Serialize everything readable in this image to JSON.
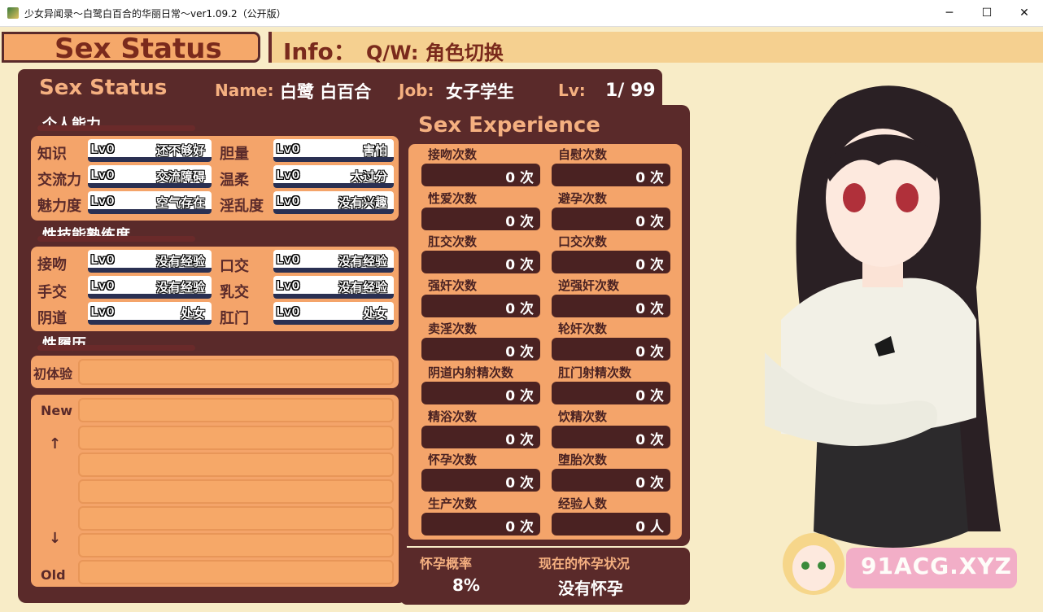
{
  "window": {
    "title": "少女异闻录～白鹭白百合的华丽日常～ver1.09.2（公开版）",
    "min_glyph": "─",
    "max_glyph": "☐",
    "close_glyph": "✕"
  },
  "header": {
    "left_title": "Sex Status",
    "info_label": "Info：",
    "info_hint": "Q/W: 角色切换"
  },
  "status": {
    "title": "Sex Status",
    "name_label": "Name:",
    "name_value": "白鹭 白百合",
    "job_label": "Job:",
    "job_value": "女子学生",
    "lv_label": "Lv:",
    "lv_value": "1/ 99"
  },
  "personal": {
    "heading": "个人能力",
    "rows": [
      {
        "label": "知识",
        "lv": "Lv0",
        "value": "还不够好"
      },
      {
        "label": "胆量",
        "lv": "Lv0",
        "value": "害怕"
      },
      {
        "label": "交流力",
        "lv": "Lv0",
        "value": "交流障碍"
      },
      {
        "label": "温柔",
        "lv": "Lv0",
        "value": "太过分"
      },
      {
        "label": "魅力度",
        "lv": "Lv0",
        "value": "空气存在"
      },
      {
        "label": "淫乱度",
        "lv": "Lv0",
        "value": "没有兴趣"
      }
    ]
  },
  "skills": {
    "heading": "性技能熟练度",
    "rows": [
      {
        "label": "接吻",
        "lv": "Lv0",
        "value": "没有经验"
      },
      {
        "label": "口交",
        "lv": "Lv0",
        "value": "没有经验"
      },
      {
        "label": "手交",
        "lv": "Lv0",
        "value": "没有经验"
      },
      {
        "label": "乳交",
        "lv": "Lv0",
        "value": "没有经验"
      },
      {
        "label": "阴道",
        "lv": "Lv0",
        "value": "处女"
      },
      {
        "label": "肛门",
        "lv": "Lv0",
        "value": "处女"
      }
    ]
  },
  "history": {
    "heading": "性履历",
    "first_label": "初体验",
    "first_value": "",
    "new_label": "New",
    "up_arrow": "↑",
    "down_arrow": "↓",
    "old_label": "Old",
    "entries": [
      "",
      "",
      "",
      "",
      "",
      ""
    ]
  },
  "experience": {
    "title": "Sex Experience",
    "items": [
      {
        "label": "接吻次数",
        "value": "0 次"
      },
      {
        "label": "自慰次数",
        "value": "0 次"
      },
      {
        "label": "性爱次数",
        "value": "0 次"
      },
      {
        "label": "避孕次数",
        "value": "0 次"
      },
      {
        "label": "肛交次数",
        "value": "0 次"
      },
      {
        "label": "口交次数",
        "value": "0 次"
      },
      {
        "label": "强奸次数",
        "value": "0 次"
      },
      {
        "label": "逆强奸次数",
        "value": "0 次"
      },
      {
        "label": "卖淫次数",
        "value": "0 次"
      },
      {
        "label": "轮奸次数",
        "value": "0 次"
      },
      {
        "label": "阴道内射精次数",
        "value": "0 次"
      },
      {
        "label": "肛门射精次数",
        "value": "0 次"
      },
      {
        "label": "精浴次数",
        "value": "0 次"
      },
      {
        "label": "饮精次数",
        "value": "0 次"
      },
      {
        "label": "怀孕次数",
        "value": "0 次"
      },
      {
        "label": "堕胎次数",
        "value": "0 次"
      },
      {
        "label": "生产次数",
        "value": "0 次"
      },
      {
        "label": "经验人数",
        "value": "0 人"
      }
    ]
  },
  "pregnancy": {
    "rate_label": "怀孕概率",
    "rate_value": "8%",
    "status_label": "现在的怀孕状况",
    "status_value": "没有怀孕"
  },
  "watermark": "91ACG.XYZ",
  "colors": {
    "panel": "#5a2a2a",
    "inner": "#f4a46a",
    "cell": "#4a2222",
    "header_text": "#7a2a1c",
    "background": "#f8ecc7"
  }
}
